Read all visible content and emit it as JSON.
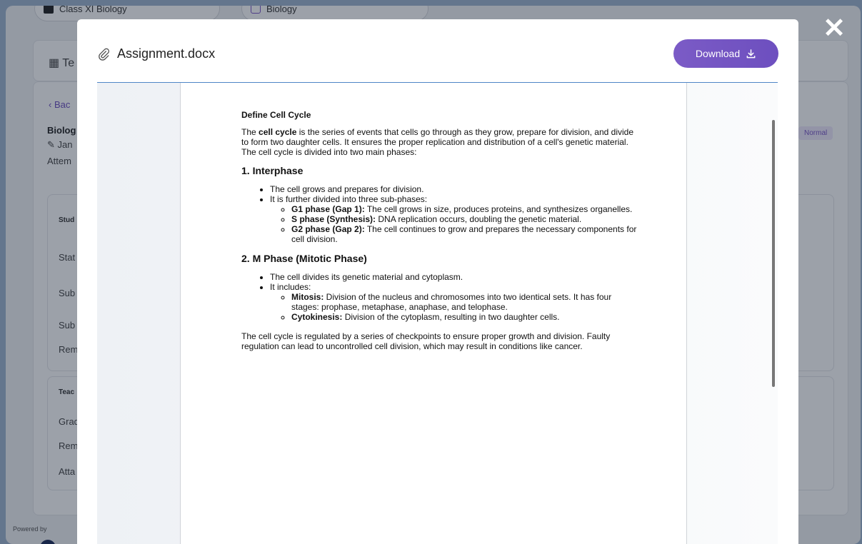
{
  "background": {
    "pills": [
      "Class XI Biology",
      "Biology"
    ],
    "sidebar_lines": [
      "Te",
      "Bac",
      "Biolog",
      "Jan",
      "Attem",
      "Stud",
      "Stat",
      "Sub",
      "Sub",
      "Rem",
      "Teac",
      "Grad",
      "Rem",
      "Atta"
    ],
    "badge": "Normal",
    "powered_by": "Powered by"
  },
  "modal": {
    "file_name": "Assignment.docx",
    "download_label": "Download"
  },
  "document": {
    "title": "Define Cell Cycle",
    "intro_before": "The ",
    "intro_bold": "cell cycle",
    "intro_after": " is the series of events that cells go through as they grow, prepare for division, and divide to form two daughter cells. It ensures the proper replication and distribution of a cell's genetic material. The cell cycle is divided into two main phases:",
    "sections": [
      {
        "heading": "1. Interphase",
        "bullets": [
          "The cell grows and prepares for division.",
          "It is further divided into three sub-phases:"
        ],
        "sub": [
          {
            "bold": "G1 phase (Gap 1):",
            "text": " The cell grows in size, produces proteins, and synthesizes organelles."
          },
          {
            "bold": "S phase (Synthesis):",
            "text": " DNA replication occurs, doubling the genetic material."
          },
          {
            "bold": "G2 phase (Gap 2):",
            "text": " The cell continues to grow and prepares the necessary components for cell division."
          }
        ]
      },
      {
        "heading": "2. M Phase (Mitotic Phase)",
        "bullets": [
          "The cell divides its genetic material and cytoplasm.",
          "It includes:"
        ],
        "sub": [
          {
            "bold": "Mitosis:",
            "text": " Division of the nucleus and chromosomes into two identical sets. It has four stages: prophase, metaphase, anaphase, and telophase."
          },
          {
            "bold": "Cytokinesis:",
            "text": " Division of the cytoplasm, resulting in two daughter cells."
          }
        ]
      }
    ],
    "conclusion": "The cell cycle is regulated by a series of checkpoints to ensure proper growth and division. Faulty regulation can lead to uncontrolled cell division, which may result in conditions like cancer."
  }
}
